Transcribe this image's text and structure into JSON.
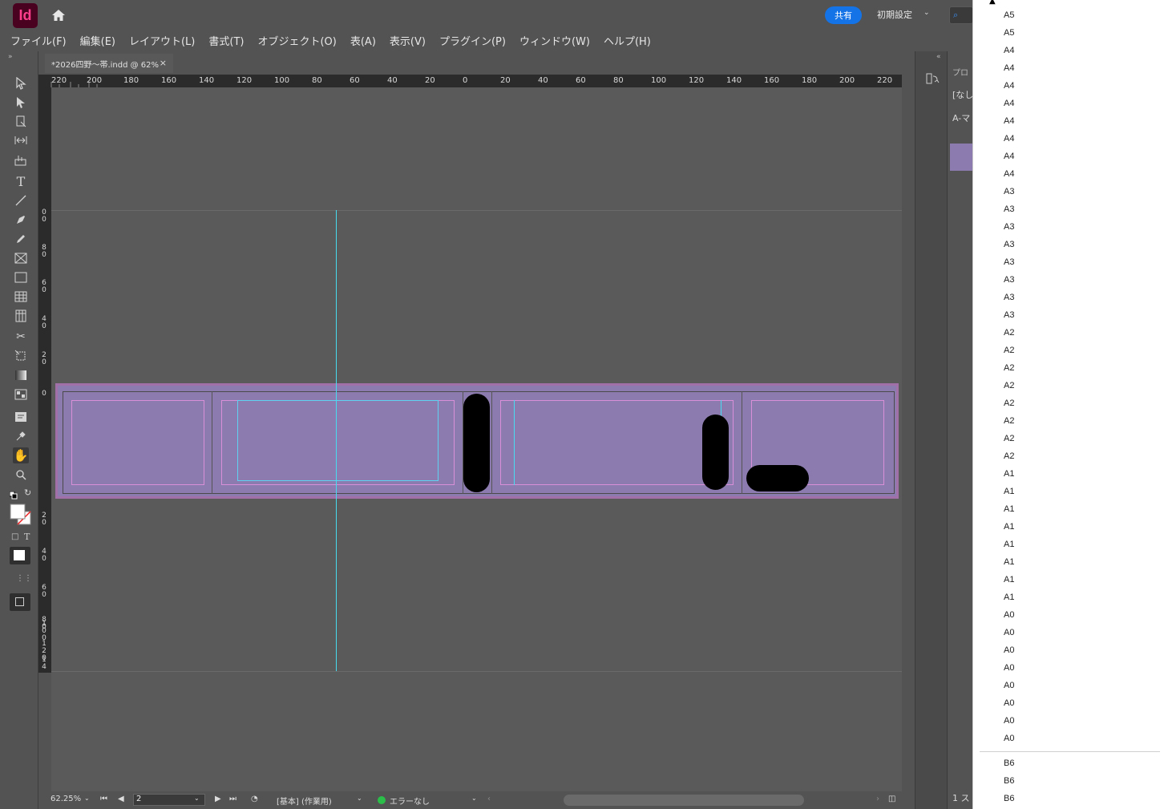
{
  "app": {
    "logo": "Id",
    "share": "共有",
    "workspace": "初期設定",
    "search_icon": "⌕"
  },
  "menu": [
    "ファイル(F)",
    "編集(E)",
    "レイアウト(L)",
    "書式(T)",
    "オブジェクト(O)",
    "表(A)",
    "表示(V)",
    "プラグイン(P)",
    "ウィンドウ(W)",
    "ヘルプ(H)"
  ],
  "document": {
    "tab_title": "*2026四野～帯.indd @ 62%",
    "tab_close": "×"
  },
  "ruler": {
    "h_labels": [
      "220",
      "200",
      "180",
      "160",
      "140",
      "120",
      "100",
      "80",
      "60",
      "40",
      "20",
      "0",
      "20",
      "40",
      "60",
      "80",
      "100",
      "120",
      "140",
      "160",
      "180",
      "200",
      "220"
    ],
    "v_labels": [
      "0 0",
      "8 0",
      "6 0",
      "4 0",
      "2 0",
      "0",
      "2 0",
      "4 0",
      "6 0",
      "8 0",
      "1 0 0",
      "1 2 0",
      "1 4"
    ]
  },
  "status": {
    "zoom": "62.25%",
    "page": "2",
    "master": "[基本] (作業用)",
    "preflight": "エラーなし"
  },
  "pages_panel": {
    "tab_label": "プロ",
    "none_label": "[なし",
    "master_label": "A-マ",
    "footer": "1 ス"
  },
  "size_list": {
    "items": [
      "A5",
      "A5",
      "A4",
      "A4",
      "A4",
      "A4",
      "A4",
      "A4",
      "A4",
      "A4",
      "A3",
      "A3",
      "A3",
      "A3",
      "A3",
      "A3",
      "A3",
      "A3",
      "A2",
      "A2",
      "A2",
      "A2",
      "A2",
      "A2",
      "A2",
      "A2",
      "A1",
      "A1",
      "A1",
      "A1",
      "A1",
      "A1",
      "A1",
      "A1",
      "A0",
      "A0",
      "A0",
      "A0",
      "A0",
      "A0",
      "A0",
      "A0"
    ],
    "items_after": [
      "B6",
      "B6",
      "B6"
    ]
  }
}
